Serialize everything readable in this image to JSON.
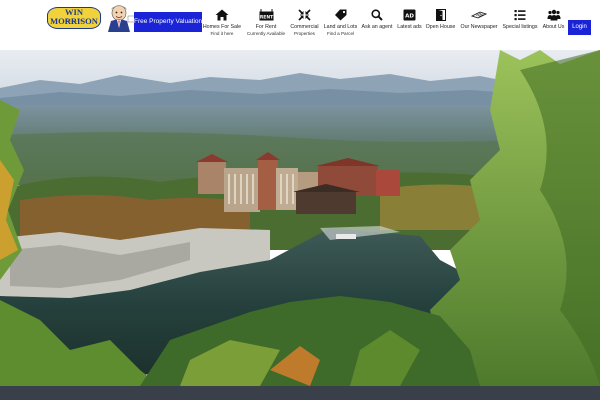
{
  "header": {
    "logo": {
      "brand_text": "WIN MORRISON",
      "sub_text": "REALTY"
    },
    "valuation_button": {
      "label": "Free Property Valuation"
    },
    "nav": [
      {
        "icon": "home-icon",
        "label": "Homes For Sale",
        "sub": "Find it here"
      },
      {
        "icon": "for-rent-sign-icon",
        "label": "For Rent",
        "sub": "Currently Available"
      },
      {
        "icon": "compress-arrows-icon",
        "label": "Commercial",
        "sub": "Properties"
      },
      {
        "icon": "tag-icon",
        "label": "Land and Lots",
        "sub": "Find a Parcel"
      },
      {
        "icon": "search-icon",
        "label": "Ask an agent",
        "sub": ""
      },
      {
        "icon": "ad-badge-icon",
        "label": "Latest ads",
        "sub": ""
      },
      {
        "icon": "door-icon",
        "label": "Open House",
        "sub": ""
      },
      {
        "icon": "newspaper-icon",
        "label": "Our Newspaper",
        "sub": ""
      },
      {
        "icon": "list-icon",
        "label": "Special listings",
        "sub": ""
      },
      {
        "icon": "users-icon",
        "label": "About Us",
        "sub": ""
      }
    ],
    "login_button": {
      "label": "Login"
    }
  },
  "hero": {
    "image": "mountain-lake-resort-autumn-photo"
  },
  "colors": {
    "primary_button": "#1a24d6",
    "footer_bar": "#3a4049",
    "logo_yellow": "#f2d23a",
    "logo_blue": "#1d3a8a"
  }
}
